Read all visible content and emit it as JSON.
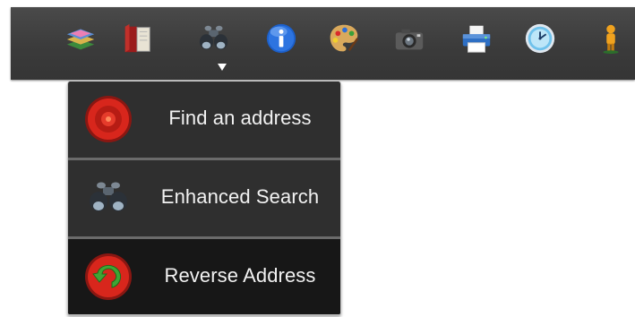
{
  "toolbar": {
    "buttons": [
      {
        "icon": "layers-icon"
      },
      {
        "icon": "map-book-icon"
      },
      {
        "icon": "binoculars-icon",
        "active": true
      },
      {
        "icon": "info-icon"
      },
      {
        "icon": "palette-icon"
      },
      {
        "icon": "camera-icon"
      },
      {
        "icon": "printer-icon"
      },
      {
        "icon": "clock-icon"
      },
      {
        "icon": "person-icon"
      }
    ]
  },
  "menu": {
    "items": [
      {
        "label": "Find an address",
        "icon": "target-icon"
      },
      {
        "label": "Enhanced Search",
        "icon": "binoculars-icon"
      },
      {
        "label": "Reverse Address",
        "icon": "reverse-arrow-icon",
        "highlighted": true
      }
    ]
  },
  "colors": {
    "toolbar_bg": "#3b3b3b",
    "menu_bg": "#2f2f2f",
    "menu_highlight": "#171717",
    "menu_text": "#f2f2f2",
    "target_red": "#d8261c",
    "arrow_green": "#3fa535"
  }
}
